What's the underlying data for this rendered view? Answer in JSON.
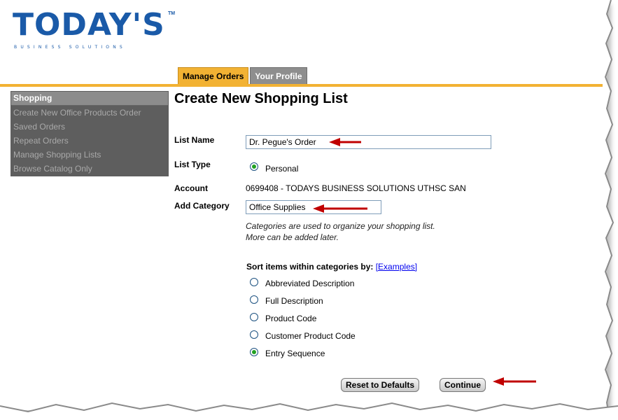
{
  "logo": {
    "word": "TODAY'S",
    "tm": "TM",
    "sub": "BUSINESS SOLUTIONS"
  },
  "tabs": [
    {
      "label": "Manage Orders",
      "active": true
    },
    {
      "label": "Your Profile",
      "active": false
    }
  ],
  "sidebar": {
    "heading": "Shopping",
    "items": [
      {
        "label": "Create New Office Products Order"
      },
      {
        "label": "Saved Orders"
      },
      {
        "label": "Repeat Orders"
      },
      {
        "label": "Manage Shopping Lists"
      },
      {
        "label": "Browse Catalog Only"
      }
    ]
  },
  "main": {
    "title": "Create New Shopping List",
    "list_name": {
      "label": "List Name",
      "value": "Dr. Pegue's Order"
    },
    "list_type": {
      "label": "List Type",
      "option": "Personal"
    },
    "account": {
      "label": "Account",
      "value": "0699408 - TODAYS BUSINESS SOLUTIONS UTHSC SAN"
    },
    "add_category": {
      "label": "Add Category",
      "value": "Office Supplies",
      "hint_line1": "Categories are used to organize your shopping list.",
      "hint_line2": "More can be added later."
    },
    "sort": {
      "heading": "Sort items within categories by:",
      "examples_link": "[Examples]",
      "options": [
        {
          "label": "Abbreviated Description",
          "checked": false
        },
        {
          "label": "Full Description",
          "checked": false
        },
        {
          "label": "Product Code",
          "checked": false
        },
        {
          "label": "Customer Product Code",
          "checked": false
        },
        {
          "label": "Entry Sequence",
          "checked": true
        }
      ]
    },
    "buttons": {
      "reset": "Reset to Defaults",
      "continue": "Continue"
    }
  },
  "colors": {
    "accent": "#f2b233",
    "logo_blue": "#1a5aa8",
    "sidebar_bg": "#5e5e5e",
    "arrow": "#c00000",
    "radio_fill": "#21a121"
  }
}
